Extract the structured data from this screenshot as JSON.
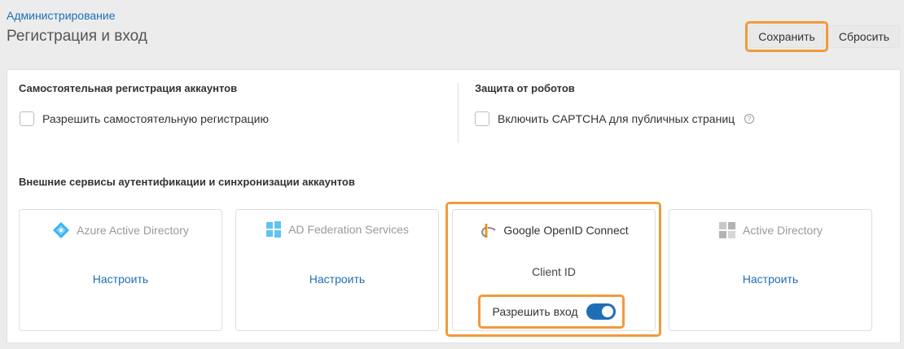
{
  "breadcrumb": "Администрирование",
  "title": "Регистрация и вход",
  "actions": {
    "save": "Сохранить",
    "reset": "Сбросить"
  },
  "self_registration": {
    "title": "Самостоятельная регистрация аккаунтов",
    "checkbox_label": "Разрешить самостоятельную регистрацию",
    "checked": false
  },
  "robots": {
    "title": "Защита от роботов",
    "checkbox_label": "Включить CAPTCHA для публичных страниц",
    "checked": false,
    "help_icon": "question-circle-icon"
  },
  "external": {
    "title": "Внешние сервисы аутентификации и синхронизации аккаунтов",
    "cards": [
      {
        "name": "Azure Active Directory",
        "icon": "azure-icon",
        "action": "Настроить"
      },
      {
        "name": "AD Federation Services",
        "icon": "windows-icon",
        "action": "Настроить"
      },
      {
        "name": "Google OpenID Connect",
        "icon": "openid-icon",
        "field": "Client ID",
        "toggle_label": "Разрешить вход",
        "toggle_on": true
      },
      {
        "name": "Active Directory",
        "icon": "active-directory-icon",
        "action": "Настроить"
      }
    ]
  },
  "colors": {
    "accent": "#1f6fb5",
    "highlight": "#f29a3a",
    "azure": "#3ab4f2",
    "openid": "#f7931e"
  }
}
